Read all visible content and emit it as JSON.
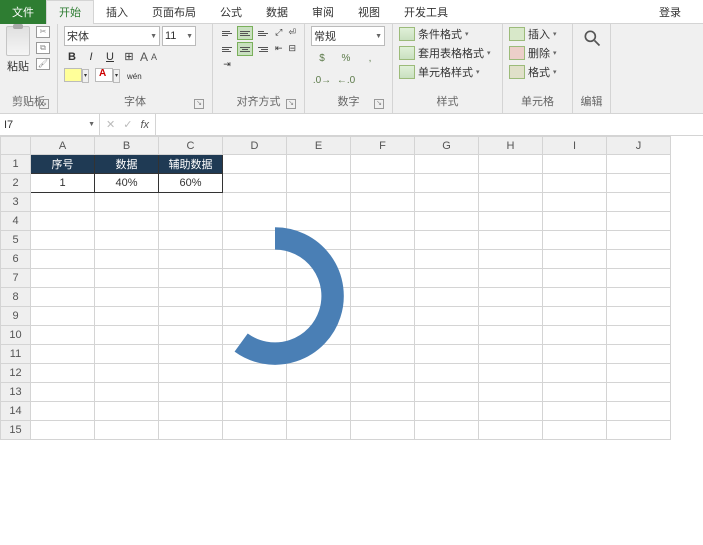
{
  "tabs": {
    "file": "文件",
    "home": "开始",
    "insert": "插入",
    "layout": "页面布局",
    "formula": "公式",
    "data": "数据",
    "review": "审阅",
    "view": "视图",
    "dev": "开发工具",
    "login": "登录"
  },
  "ribbon": {
    "clipboard": {
      "label": "剪贴板",
      "paste": "粘贴"
    },
    "font": {
      "label": "字体",
      "name": "宋体",
      "size": "11",
      "bold": "B",
      "italic": "I",
      "underline": "U"
    },
    "align": {
      "label": "对齐方式"
    },
    "number": {
      "label": "数字",
      "format": "常规"
    },
    "styles": {
      "label": "样式",
      "cond": "条件格式",
      "table": "套用表格格式",
      "cell": "单元格样式"
    },
    "cells": {
      "label": "单元格",
      "insert": "插入",
      "delete": "删除",
      "format": "格式"
    },
    "edit": {
      "label": "编辑"
    }
  },
  "namebox": "I7",
  "formula": "",
  "columns": [
    "A",
    "B",
    "C",
    "D",
    "E",
    "F",
    "G",
    "H",
    "I",
    "J"
  ],
  "rows": [
    "1",
    "2",
    "3",
    "4",
    "5",
    "6",
    "7",
    "8",
    "9",
    "10",
    "11",
    "12",
    "13",
    "14",
    "15"
  ],
  "table": {
    "headers": [
      "序号",
      "数据",
      "辅助数据"
    ],
    "row": [
      "1",
      "40%",
      "60%"
    ]
  },
  "chart_data": {
    "type": "doughnut",
    "categories": [
      "数据",
      "辅助数据"
    ],
    "values": [
      40,
      60
    ],
    "visible_arc_start_deg": 0,
    "visible_arc_end_deg": 216,
    "color": "#4a7fb5"
  }
}
